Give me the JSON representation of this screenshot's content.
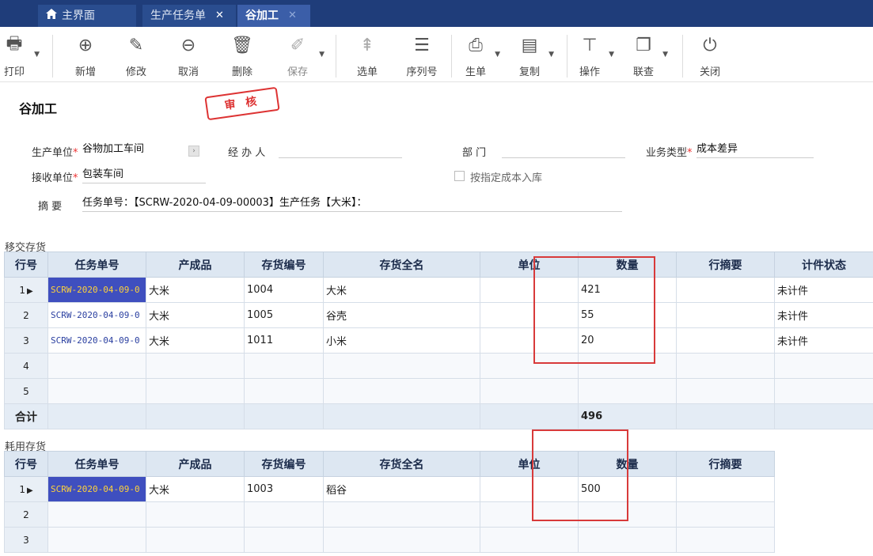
{
  "tabs": [
    {
      "label": "主界面",
      "icon": "home-icon"
    },
    {
      "label": "生产任务单",
      "close": "✕"
    },
    {
      "label": "谷加工",
      "close": "✕",
      "active": true
    }
  ],
  "toolbar": [
    {
      "label": "打印",
      "icon": "printer-icon",
      "glyph": "🖶",
      "dropdown": true
    },
    {
      "label": "新增",
      "icon": "add-icon",
      "glyph": "⊕"
    },
    {
      "label": "修改",
      "icon": "edit-icon",
      "glyph": "✎"
    },
    {
      "label": "取消",
      "icon": "cancel-icon",
      "glyph": "⊖"
    },
    {
      "label": "删除",
      "icon": "trash-icon",
      "glyph": "🗑"
    },
    {
      "label": "保存",
      "icon": "save-icon",
      "glyph": "✐",
      "dropdown": true
    },
    {
      "label": "选单",
      "icon": "select-order-icon",
      "glyph": "⇞"
    },
    {
      "label": "序列号",
      "icon": "serial-icon",
      "glyph": "☰"
    },
    {
      "label": "生单",
      "icon": "generate-order-icon",
      "glyph": "⎙",
      "dropdown": true
    },
    {
      "label": "复制",
      "icon": "copy-icon",
      "glyph": "▤",
      "dropdown": true
    },
    {
      "label": "操作",
      "icon": "operate-icon",
      "glyph": "⊤",
      "dropdown": true
    },
    {
      "label": "联查",
      "icon": "linked-query-icon",
      "glyph": "❐",
      "dropdown": true
    },
    {
      "label": "关闭",
      "icon": "power-icon",
      "glyph": "⏻"
    }
  ],
  "page": {
    "title": "谷加工",
    "stamp": "审 核"
  },
  "form": {
    "prod_unit_label": "生产单位",
    "prod_unit_value": "谷物加工车间",
    "handler_label": "经 办 人",
    "handler_value": "",
    "dept_label": "部    门",
    "dept_value": "",
    "biz_type_label": "业务类型",
    "biz_type_value": "成本差异",
    "recv_unit_label": "接收单位",
    "recv_unit_value": "包装车间",
    "cost_checkbox_label": "按指定成本入库",
    "summary_label": "摘    要",
    "summary_value": "任务单号：【SCRW-2020-04-09-00003】生产任务【大米】："
  },
  "transfer": {
    "section_label": "移交存货",
    "headers": [
      "行号",
      "任务单号",
      "产成品",
      "存货编号",
      "存货全名",
      "单位",
      "数量",
      "行摘要",
      "计件状态"
    ],
    "rows": [
      {
        "no": "1",
        "task": "SCRW-2020-04-09-0",
        "product": "大米",
        "code": "1004",
        "name": "大米",
        "unit": "",
        "qty": "421",
        "memo": "",
        "status": "未计件"
      },
      {
        "no": "2",
        "task": "SCRW-2020-04-09-0",
        "product": "大米",
        "code": "1005",
        "name": "谷壳",
        "unit": "",
        "qty": "55",
        "memo": "",
        "status": "未计件"
      },
      {
        "no": "3",
        "task": "SCRW-2020-04-09-0",
        "product": "大米",
        "code": "1011",
        "name": "小米",
        "unit": "",
        "qty": "20",
        "memo": "",
        "status": "未计件"
      }
    ],
    "empty_rows": [
      "4",
      "5"
    ],
    "sum_label": "合计",
    "sum_qty": "496"
  },
  "consume": {
    "section_label": "耗用存货",
    "headers": [
      "行号",
      "任务单号",
      "产成品",
      "存货编号",
      "存货全名",
      "单位",
      "数量",
      "行摘要"
    ],
    "rows": [
      {
        "no": "1",
        "task": "SCRW-2020-04-09-0",
        "product": "大米",
        "code": "1003",
        "name": "稻谷",
        "unit": "",
        "qty": "500",
        "memo": ""
      }
    ],
    "empty_rows": [
      "2",
      "3"
    ]
  },
  "colors": {
    "tabbar": "#1f3d7a",
    "grid_header": "#dde7f2",
    "highlight_box": "#d83a3a",
    "required": "#e33333"
  }
}
